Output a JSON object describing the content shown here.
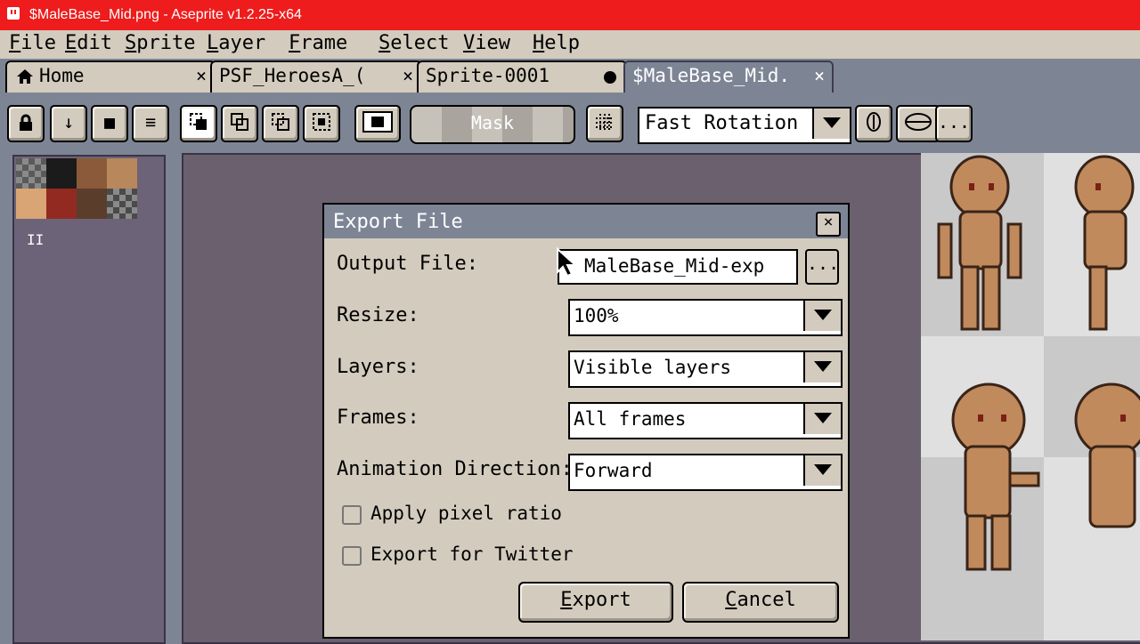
{
  "window": {
    "title": "$MaleBase_Mid.png - Aseprite v1.2.25-x64"
  },
  "menu": [
    "File",
    "Edit",
    "Sprite",
    "Layer",
    "Frame",
    "Select",
    "View",
    "Help"
  ],
  "tabs": [
    {
      "label": "Home",
      "close": "×",
      "icon": "home-icon"
    },
    {
      "label": "PSF_HeroesA_(",
      "close": "×"
    },
    {
      "label": "Sprite-0001",
      "modified": true
    },
    {
      "label": "$MaleBase_Mid.",
      "close": "×",
      "active": true
    }
  ],
  "toolbar": {
    "buttons_left": [
      "lock-icon",
      "arrow-down-icon",
      "square-icon",
      "menu-lines-icon"
    ],
    "buttons_mid": [
      "select-rect-icon",
      "select-add-icon",
      "select-subtract-icon",
      "select-intersect-icon",
      "transparent-color-icon"
    ],
    "mask_label": "Mask",
    "grid_icon": "grid-icon",
    "rotation_algorithm": "Fast Rotation",
    "right_icons": [
      "pivot-icon",
      "transform-icon"
    ],
    "more_label": "..."
  },
  "palette": {
    "colors": [
      "#6f6f6f",
      "#1b1b1b",
      "#8b5a3a",
      "#b8875c",
      "#d9a574",
      "#922a22",
      "#5a3d2b",
      "#5f5f5f"
    ],
    "handle": "II"
  },
  "dialog": {
    "title": "Export File",
    "close": "×",
    "output_label": "Output File:",
    "output_value": "MaleBase_Mid-exp",
    "browse_label": "...",
    "resize_label": "Resize:",
    "resize_value": "100%",
    "layers_label": "Layers:",
    "layers_value": "Visible layers",
    "frames_label": "Frames:",
    "frames_value": "All frames",
    "direction_label": "Animation Direction:",
    "direction_value": "Forward",
    "pixel_ratio_label": "Apply pixel ratio",
    "pixel_ratio_checked": false,
    "twitter_label": "Export for Twitter",
    "twitter_checked": false,
    "export_button": "Export",
    "cancel_button": "Cancel"
  },
  "colors": {
    "titlebar": "#ee1c1c",
    "panel": "#d3cbbe",
    "workspace": "#7d8595",
    "canvas": "#6a606e"
  }
}
